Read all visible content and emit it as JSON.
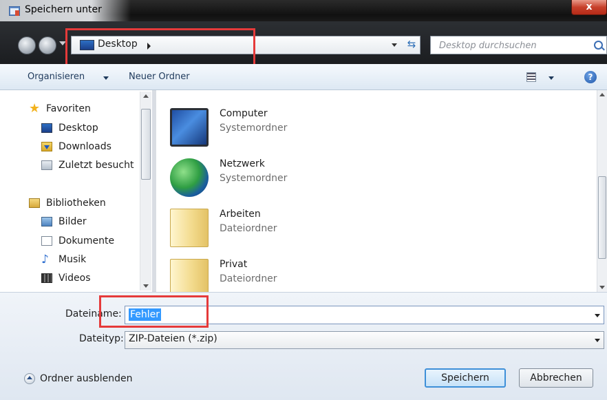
{
  "window": {
    "title": "Speichern unter",
    "close_label": "x"
  },
  "address": {
    "location": "Desktop"
  },
  "search": {
    "placeholder": "Desktop durchsuchen"
  },
  "toolbar": {
    "organize_label": "Organisieren",
    "new_folder_label": "Neuer Ordner"
  },
  "sidebar": {
    "favorites": [
      {
        "label": "Favoriten",
        "icon": "star-icon"
      },
      {
        "label": "Desktop",
        "icon": "desktop-icon"
      },
      {
        "label": "Downloads",
        "icon": "downloads-icon"
      },
      {
        "label": "Zuletzt besucht",
        "icon": "recent-places-icon"
      }
    ],
    "libraries": [
      {
        "label": "Bibliotheken",
        "icon": "libraries-icon"
      },
      {
        "label": "Bilder",
        "icon": "pictures-icon"
      },
      {
        "label": "Dokumente",
        "icon": "documents-icon"
      },
      {
        "label": "Musik",
        "icon": "music-icon"
      },
      {
        "label": "Videos",
        "icon": "videos-icon"
      }
    ]
  },
  "files": [
    {
      "name": "Computer",
      "type": "Systemordner",
      "icon": "computer-icon"
    },
    {
      "name": "Netzwerk",
      "type": "Systemordner",
      "icon": "network-icon"
    },
    {
      "name": "Arbeiten",
      "type": "Dateiordner",
      "icon": "folder-icon"
    },
    {
      "name": "Privat",
      "type": "Dateiordner",
      "icon": "folder-icon"
    }
  ],
  "form": {
    "filename_label": "Dateiname:",
    "filename_value": "Fehler",
    "filetype_label": "Dateityp:",
    "filetype_value": "ZIP-Dateien (*.zip)"
  },
  "footer": {
    "hide_folders_label": "Ordner ausblenden",
    "save_label": "Speichern",
    "cancel_label": "Abbrechen"
  },
  "colors": {
    "highlight_box": "#e53a3a",
    "selection": "#3399ff"
  }
}
